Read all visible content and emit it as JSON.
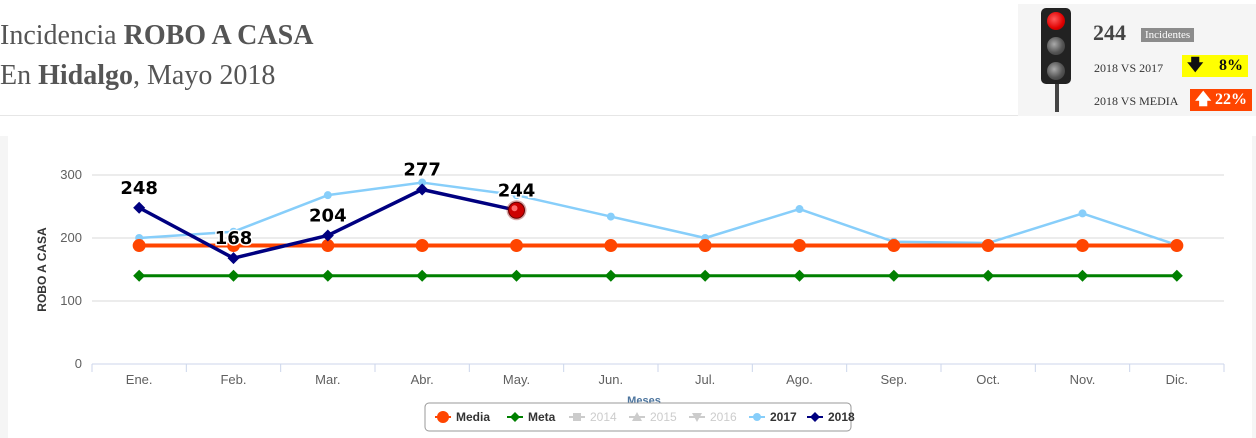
{
  "header": {
    "line1_prefix": "Incidencia ",
    "line1_bold": "ROBO A CASA",
    "line2_prefix": "En ",
    "line2_bold": "Hidalgo",
    "line2_suffix": ", Mayo 2018"
  },
  "kpi": {
    "count": "244",
    "count_badge": "Incidentes",
    "compare_prev_label": "2018 VS 2017",
    "compare_prev_value": "8%",
    "compare_prev_icon": "arrow-down-icon",
    "compare_prev_color": "#ffff00",
    "compare_media_label": "2018 VS MEDIA",
    "compare_media_value": "22%",
    "compare_media_icon": "arrow-up-icon",
    "compare_media_color": "#ff4500",
    "traffic_light_state": "red"
  },
  "chart_data": {
    "type": "line",
    "categories": [
      "Ene.",
      "Feb.",
      "Mar.",
      "Abr.",
      "May.",
      "Jun.",
      "Jul.",
      "Ago.",
      "Sep.",
      "Oct.",
      "Nov.",
      "Dic."
    ],
    "ylabel": "ROBO A CASA",
    "xlabel": "Meses",
    "ylim": [
      0,
      300
    ],
    "yticks": [
      0,
      100,
      200,
      300
    ],
    "grid": true,
    "legend_position": "bottom-center",
    "series": [
      {
        "name": "Media",
        "color": "#ff4500",
        "marker": "circle",
        "hidden": false,
        "values": [
          188,
          188,
          188,
          188,
          188,
          188,
          188,
          188,
          188,
          188,
          188,
          188
        ]
      },
      {
        "name": "Meta",
        "color": "#008000",
        "marker": "diamond",
        "hidden": false,
        "values": [
          140,
          140,
          140,
          140,
          140,
          140,
          140,
          140,
          140,
          140,
          140,
          140
        ]
      },
      {
        "name": "2014",
        "color": "#cccccc",
        "marker": "square",
        "hidden": true,
        "values": []
      },
      {
        "name": "2015",
        "color": "#cccccc",
        "marker": "triangle",
        "hidden": true,
        "values": []
      },
      {
        "name": "2016",
        "color": "#cccccc",
        "marker": "triangle-down",
        "hidden": true,
        "values": []
      },
      {
        "name": "2017",
        "color": "#87cefa",
        "marker": "circle",
        "hidden": false,
        "values": [
          200,
          210,
          268,
          288,
          268,
          234,
          200,
          246,
          194,
          192,
          239,
          189
        ]
      },
      {
        "name": "2018",
        "color": "#000080",
        "marker": "diamond",
        "hidden": false,
        "values": [
          248,
          168,
          204,
          277,
          244,
          null,
          null,
          null,
          null,
          null,
          null,
          null
        ],
        "data_labels": [
          "248",
          "168",
          "204",
          "277",
          "244"
        ]
      }
    ]
  }
}
